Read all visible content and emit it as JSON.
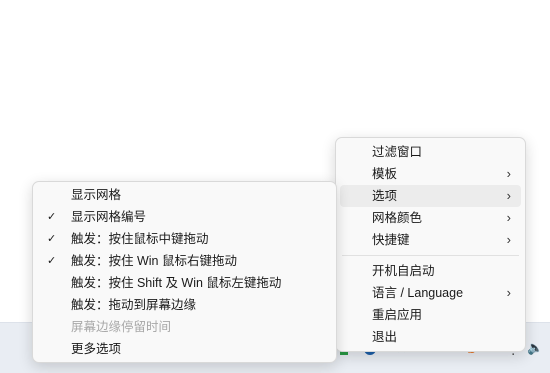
{
  "main_menu": {
    "items": [
      {
        "label": "过滤窗口",
        "submenu": false
      },
      {
        "label": "模板",
        "submenu": true
      },
      {
        "label": "选项",
        "submenu": true,
        "hover": true
      },
      {
        "label": "网格颜色",
        "submenu": true
      },
      {
        "label": "快捷键",
        "submenu": true
      }
    ],
    "items2": [
      {
        "label": "开机自启动",
        "submenu": false
      },
      {
        "label": "语言 / Language",
        "submenu": true
      },
      {
        "label": "重启应用",
        "submenu": false
      },
      {
        "label": "退出",
        "submenu": false
      }
    ]
  },
  "options_menu": {
    "items": [
      {
        "label": "显示网格",
        "checked": false,
        "disabled": false
      },
      {
        "label": "显示网格编号",
        "checked": true,
        "disabled": false
      },
      {
        "label": "触发：按住鼠标中键拖动",
        "checked": true,
        "disabled": false
      },
      {
        "label": "触发：按住 Win 鼠标右键拖动",
        "checked": true,
        "disabled": false
      },
      {
        "label": "触发：按住 Shift 及 Win 鼠标左键拖动",
        "checked": false,
        "disabled": false
      },
      {
        "label": "触发：拖动到屏幕边缘",
        "checked": false,
        "disabled": false
      },
      {
        "label": "屏幕边缘停留时间",
        "checked": false,
        "disabled": true
      },
      {
        "label": "更多选项",
        "checked": false,
        "disabled": false
      }
    ]
  },
  "icons": {
    "check": "✓",
    "chevron": "›"
  }
}
